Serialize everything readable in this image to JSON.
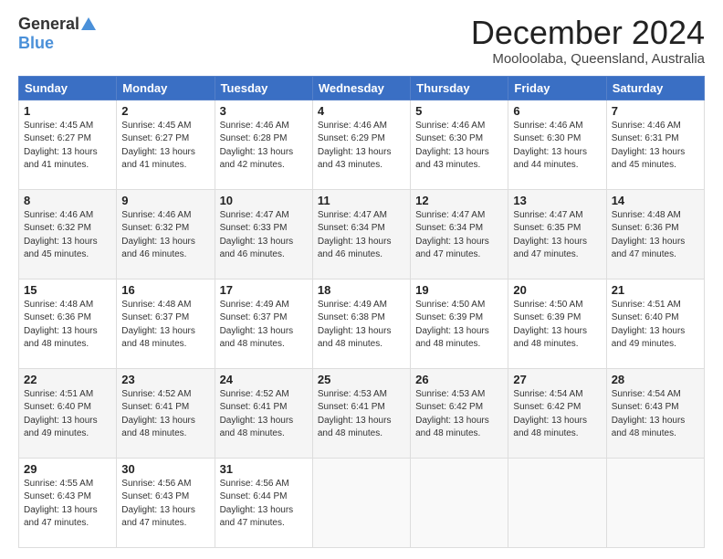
{
  "header": {
    "logo_general": "General",
    "logo_blue": "Blue",
    "title": "December 2024",
    "location": "Mooloolaba, Queensland, Australia"
  },
  "days_of_week": [
    "Sunday",
    "Monday",
    "Tuesday",
    "Wednesday",
    "Thursday",
    "Friday",
    "Saturday"
  ],
  "weeks": [
    [
      {
        "day": "1",
        "info": "Sunrise: 4:45 AM\nSunset: 6:27 PM\nDaylight: 13 hours and 41 minutes."
      },
      {
        "day": "2",
        "info": "Sunrise: 4:45 AM\nSunset: 6:27 PM\nDaylight: 13 hours and 41 minutes."
      },
      {
        "day": "3",
        "info": "Sunrise: 4:46 AM\nSunset: 6:28 PM\nDaylight: 13 hours and 42 minutes."
      },
      {
        "day": "4",
        "info": "Sunrise: 4:46 AM\nSunset: 6:29 PM\nDaylight: 13 hours and 43 minutes."
      },
      {
        "day": "5",
        "info": "Sunrise: 4:46 AM\nSunset: 6:30 PM\nDaylight: 13 hours and 43 minutes."
      },
      {
        "day": "6",
        "info": "Sunrise: 4:46 AM\nSunset: 6:30 PM\nDaylight: 13 hours and 44 minutes."
      },
      {
        "day": "7",
        "info": "Sunrise: 4:46 AM\nSunset: 6:31 PM\nDaylight: 13 hours and 45 minutes."
      }
    ],
    [
      {
        "day": "8",
        "info": "Sunrise: 4:46 AM\nSunset: 6:32 PM\nDaylight: 13 hours and 45 minutes."
      },
      {
        "day": "9",
        "info": "Sunrise: 4:46 AM\nSunset: 6:32 PM\nDaylight: 13 hours and 46 minutes."
      },
      {
        "day": "10",
        "info": "Sunrise: 4:47 AM\nSunset: 6:33 PM\nDaylight: 13 hours and 46 minutes."
      },
      {
        "day": "11",
        "info": "Sunrise: 4:47 AM\nSunset: 6:34 PM\nDaylight: 13 hours and 46 minutes."
      },
      {
        "day": "12",
        "info": "Sunrise: 4:47 AM\nSunset: 6:34 PM\nDaylight: 13 hours and 47 minutes."
      },
      {
        "day": "13",
        "info": "Sunrise: 4:47 AM\nSunset: 6:35 PM\nDaylight: 13 hours and 47 minutes."
      },
      {
        "day": "14",
        "info": "Sunrise: 4:48 AM\nSunset: 6:36 PM\nDaylight: 13 hours and 47 minutes."
      }
    ],
    [
      {
        "day": "15",
        "info": "Sunrise: 4:48 AM\nSunset: 6:36 PM\nDaylight: 13 hours and 48 minutes."
      },
      {
        "day": "16",
        "info": "Sunrise: 4:48 AM\nSunset: 6:37 PM\nDaylight: 13 hours and 48 minutes."
      },
      {
        "day": "17",
        "info": "Sunrise: 4:49 AM\nSunset: 6:37 PM\nDaylight: 13 hours and 48 minutes."
      },
      {
        "day": "18",
        "info": "Sunrise: 4:49 AM\nSunset: 6:38 PM\nDaylight: 13 hours and 48 minutes."
      },
      {
        "day": "19",
        "info": "Sunrise: 4:50 AM\nSunset: 6:39 PM\nDaylight: 13 hours and 48 minutes."
      },
      {
        "day": "20",
        "info": "Sunrise: 4:50 AM\nSunset: 6:39 PM\nDaylight: 13 hours and 48 minutes."
      },
      {
        "day": "21",
        "info": "Sunrise: 4:51 AM\nSunset: 6:40 PM\nDaylight: 13 hours and 49 minutes."
      }
    ],
    [
      {
        "day": "22",
        "info": "Sunrise: 4:51 AM\nSunset: 6:40 PM\nDaylight: 13 hours and 49 minutes."
      },
      {
        "day": "23",
        "info": "Sunrise: 4:52 AM\nSunset: 6:41 PM\nDaylight: 13 hours and 48 minutes."
      },
      {
        "day": "24",
        "info": "Sunrise: 4:52 AM\nSunset: 6:41 PM\nDaylight: 13 hours and 48 minutes."
      },
      {
        "day": "25",
        "info": "Sunrise: 4:53 AM\nSunset: 6:41 PM\nDaylight: 13 hours and 48 minutes."
      },
      {
        "day": "26",
        "info": "Sunrise: 4:53 AM\nSunset: 6:42 PM\nDaylight: 13 hours and 48 minutes."
      },
      {
        "day": "27",
        "info": "Sunrise: 4:54 AM\nSunset: 6:42 PM\nDaylight: 13 hours and 48 minutes."
      },
      {
        "day": "28",
        "info": "Sunrise: 4:54 AM\nSunset: 6:43 PM\nDaylight: 13 hours and 48 minutes."
      }
    ],
    [
      {
        "day": "29",
        "info": "Sunrise: 4:55 AM\nSunset: 6:43 PM\nDaylight: 13 hours and 47 minutes."
      },
      {
        "day": "30",
        "info": "Sunrise: 4:56 AM\nSunset: 6:43 PM\nDaylight: 13 hours and 47 minutes."
      },
      {
        "day": "31",
        "info": "Sunrise: 4:56 AM\nSunset: 6:44 PM\nDaylight: 13 hours and 47 minutes."
      },
      {
        "day": "",
        "info": ""
      },
      {
        "day": "",
        "info": ""
      },
      {
        "day": "",
        "info": ""
      },
      {
        "day": "",
        "info": ""
      }
    ]
  ]
}
